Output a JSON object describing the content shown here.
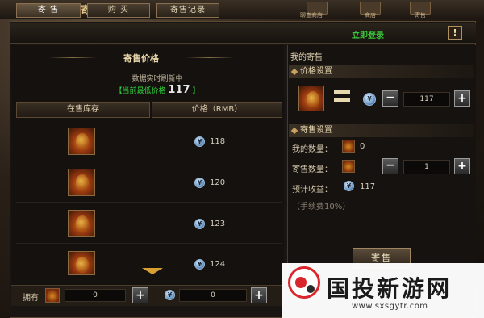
{
  "window": {
    "title": "寄售"
  },
  "top_icons": [
    {
      "label": "聊查商店"
    },
    {
      "label": "商店"
    },
    {
      "label": "寄售"
    }
  ],
  "tabs": [
    {
      "label": "寄 售",
      "active": true
    },
    {
      "label": "购 买",
      "active": false
    },
    {
      "label": "寄售记录",
      "active": false
    }
  ],
  "login_link": "立即登录",
  "help_button": "!",
  "left": {
    "title": "寄售价格",
    "refresh_text": "数据实时刷新中",
    "min_price_label": "【当前最低价格",
    "min_price_value": "117",
    "min_price_close": "】",
    "columns": [
      "在售库存",
      "价格（RMB）"
    ],
    "rows": [
      {
        "price": "118"
      },
      {
        "price": "120"
      },
      {
        "price": "123"
      },
      {
        "price": "124"
      }
    ]
  },
  "bottom": {
    "owned_label": "拥有",
    "item_count": "0",
    "coin_count": "0"
  },
  "right": {
    "title": "我的寄售",
    "price_section": "价格设置",
    "price_value": "117",
    "sell_section": "寄售设置",
    "my_qty_label": "我的数量：",
    "my_qty_value": "0",
    "sell_qty_label": "寄售数量：",
    "sell_qty_value": "1",
    "income_label": "预计收益：",
    "income_value": "117",
    "fee_note": "（手续费10%）",
    "sell_button": "寄售"
  },
  "watermark": {
    "name": "国投新游网",
    "url": "www.sxsgytr.com"
  },
  "colors": {
    "accent_gold": "#e0c488",
    "login_green": "#3ac83a",
    "min_price_green": "#2ed23a"
  }
}
